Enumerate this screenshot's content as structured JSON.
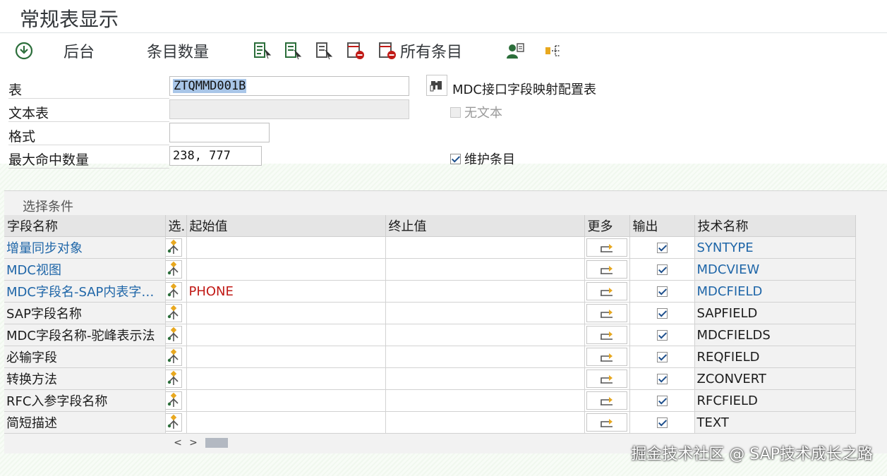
{
  "title": "常规表显示",
  "toolbar": {
    "background": "后台",
    "entry_count": "条目数量",
    "all_entries": "所有条目"
  },
  "form": {
    "table_label": "表",
    "table_value": "ZTQMMD001B",
    "table_desc": "MDC接口字段映射配置表",
    "text_table_label": "文本表",
    "text_table_value": "",
    "no_text_label": "无文本",
    "format_label": "格式",
    "format_value": "",
    "max_hits_label": "最大命中数量",
    "max_hits_value": "238, 777",
    "maintain_label": "维护条目"
  },
  "selection": {
    "title": "选择条件",
    "headers": [
      "字段名称",
      "选.",
      "起始值",
      "终止值",
      "更多",
      "输出",
      "技术名称"
    ],
    "rows": [
      {
        "name": "增量同步对象",
        "from": "",
        "to": "",
        "output": true,
        "tech": "SYNTYPE",
        "link": true
      },
      {
        "name": "MDC视图",
        "from": "",
        "to": "",
        "output": true,
        "tech": "MDCVIEW",
        "link": true
      },
      {
        "name": "MDC字段名-SAP内表字段...",
        "from": "PHONE",
        "to": "",
        "output": true,
        "tech": "MDCFIELD",
        "link": true
      },
      {
        "name": "SAP字段名称",
        "from": "",
        "to": "",
        "output": true,
        "tech": "SAPFIELD",
        "link": false
      },
      {
        "name": "MDC字段名称-驼峰表示法",
        "from": "",
        "to": "",
        "output": true,
        "tech": "MDCFIELDS",
        "link": false
      },
      {
        "name": "必输字段",
        "from": "",
        "to": "",
        "output": true,
        "tech": "REQFIELD",
        "link": false
      },
      {
        "name": "转换方法",
        "from": "",
        "to": "",
        "output": true,
        "tech": "ZCONVERT",
        "link": false
      },
      {
        "name": "RFC入参字段名称",
        "from": "",
        "to": "",
        "output": true,
        "tech": "RFCFIELD",
        "link": false
      },
      {
        "name": "简短描述",
        "from": "",
        "to": "",
        "output": true,
        "tech": "TEXT",
        "link": false
      }
    ]
  },
  "scroll": {
    "left": "<",
    "right": ">"
  },
  "watermark": "掘金技术社区 @ SAP技术成长之路",
  "colors": {
    "link": "#1f66a8",
    "value_red": "#c11b17",
    "accent": "#1d4f8c"
  }
}
